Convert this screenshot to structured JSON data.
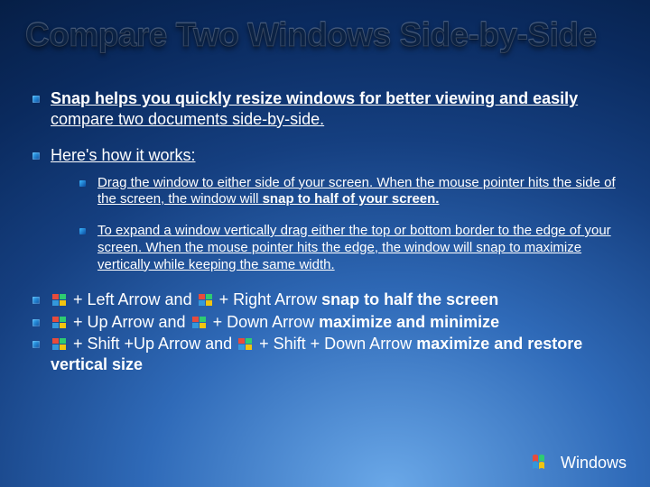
{
  "title": "Compare Two Windows Side-by-Side",
  "bullets": {
    "b1_lead": "Snap helps you quickly resize windows for better viewing and easily",
    "b1_rest": " compare two documents side-by-side.",
    "b2": "Here's how it works:",
    "sub1_a": "Drag the window to either side of your screen. When the mouse pointer hits the side of the screen, the window will ",
    "sub1_b": "snap to half of your screen.",
    "sub2": "To expand a window vertically drag either the top or bottom border to the edge of your screen. When the mouse pointer hits the edge, the window will snap to maximize vertically while keeping the same width.",
    "b3a_pre": " + Left Arrow and ",
    "b3a_mid": " + Right Arrow ",
    "b3a_bold": "snap to half the screen",
    "b3b_pre": " + Up Arrow and ",
    "b3b_mid": " + Down Arrow ",
    "b3b_bold": "maximize and minimize",
    "b3c_pre": " + Shift +Up Arrow and ",
    "b3c_mid": " + Shift + Down Arrow ",
    "b3c_bold": "maximize and restore vertical size"
  },
  "footer": {
    "brand": "Windows"
  }
}
